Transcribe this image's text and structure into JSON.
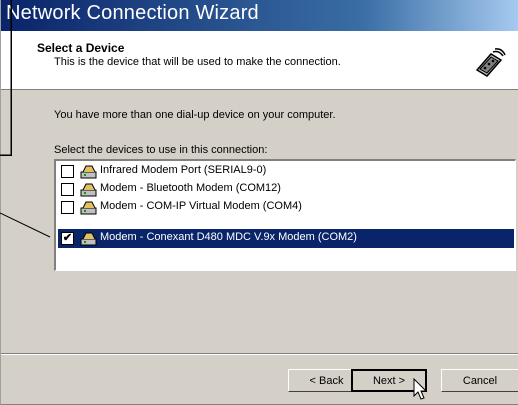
{
  "window": {
    "title": "Network Connection Wizard"
  },
  "header": {
    "title": "Select a Device",
    "subtitle": "This is the device that will be used to make the connection.",
    "icon": "phone-connection-icon"
  },
  "body": {
    "intro": "You have more than one dial-up device on your computer.",
    "devices_label": "Select the devices to use in this connection:"
  },
  "devices": [
    {
      "label": "Infrared Modem Port (SERIAL9-0)",
      "checked": false,
      "selected": false
    },
    {
      "label": "Modem - Bluetooth Modem (COM12)",
      "checked": false,
      "selected": false
    },
    {
      "label": "Modem - COM-IP Virtual Modem (COM4)",
      "checked": false,
      "selected": false
    },
    {
      "label": "Modem - Conexant D480 MDC V.9x Modem (COM2)",
      "checked": true,
      "selected": true
    }
  ],
  "buttons": {
    "back": "< Back",
    "next": "Next >",
    "cancel": "Cancel"
  },
  "colors": {
    "titlebar_start": "#0a246a",
    "titlebar_end": "#a6caf0",
    "selection": "#0a246a",
    "face": "#d4d0c8"
  }
}
